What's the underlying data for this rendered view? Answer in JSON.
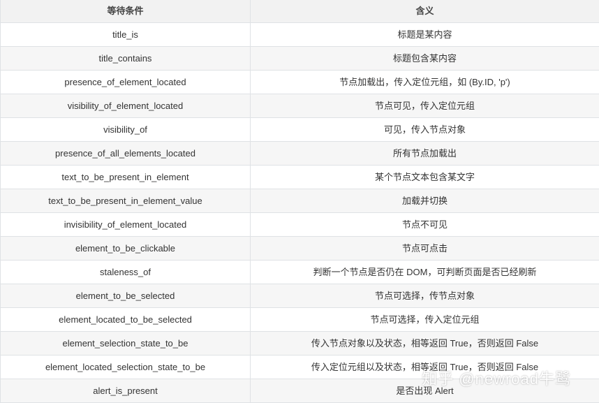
{
  "table": {
    "headers": [
      "等待条件",
      "含义"
    ],
    "rows": [
      [
        "title_is",
        "标题是某内容"
      ],
      [
        "title_contains",
        "标题包含某内容"
      ],
      [
        "presence_of_element_located",
        "节点加载出，传入定位元组，如 (By.ID, 'p')"
      ],
      [
        "visibility_of_element_located",
        "节点可见，传入定位元组"
      ],
      [
        "visibility_of",
        "可见，传入节点对象"
      ],
      [
        "presence_of_all_elements_located",
        "所有节点加载出"
      ],
      [
        "text_to_be_present_in_element",
        "某个节点文本包含某文字"
      ],
      [
        "text_to_be_present_in_element_value",
        "加载并切换"
      ],
      [
        "invisibility_of_element_located",
        "节点不可见"
      ],
      [
        "element_to_be_clickable",
        "节点可点击"
      ],
      [
        "staleness_of",
        "判断一个节点是否仍在 DOM，可判断页面是否已经刷新"
      ],
      [
        "element_to_be_selected",
        "节点可选择，传节点对象"
      ],
      [
        "element_located_to_be_selected",
        "节点可选择，传入定位元组"
      ],
      [
        "element_selection_state_to_be",
        "传入节点对象以及状态，相等返回 True，否则返回 False"
      ],
      [
        "element_located_selection_state_to_be",
        "传入定位元组以及状态，相等返回 True，否则返回 False"
      ],
      [
        "alert_is_present",
        "是否出现 Alert"
      ]
    ]
  },
  "watermark": "知乎 @newroad牛鹭"
}
